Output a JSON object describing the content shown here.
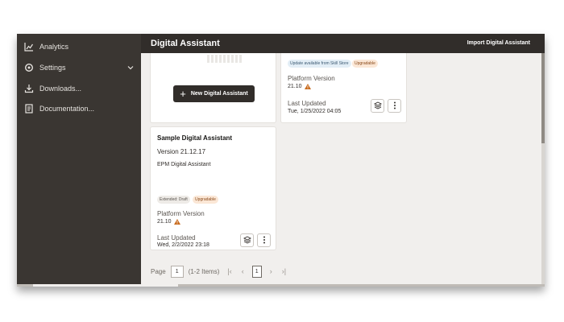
{
  "sidebar": {
    "items": [
      {
        "label": "Analytics",
        "icon": "analytics-icon"
      },
      {
        "label": "Settings",
        "icon": "gear-icon"
      },
      {
        "label": "Downloads...",
        "icon": "download-icon"
      },
      {
        "label": "Documentation...",
        "icon": "document-icon"
      }
    ]
  },
  "header": {
    "title": "Digital Assistant",
    "import_label": "Import Digital Assistant"
  },
  "cards": {
    "new_button_label": "New Digital Assistant",
    "second": {
      "badge_update": "Update available from Skill Store",
      "badge_upgradable": "Upgradable",
      "platform_label": "Platform Version",
      "platform_value": "21.10",
      "updated_label": "Last Updated",
      "updated_value": "Tue, 1/25/2022 04:05"
    },
    "sample": {
      "name": "Sample Digital Assistant",
      "version": "Version 21.12.17",
      "description": "EPM Digital Assistant",
      "badge_draft": "Extended: Draft",
      "badge_upgradable": "Upgradable",
      "platform_label": "Platform Version",
      "platform_value": "21.10",
      "updated_label": "Last Updated",
      "updated_value": "Wed, 2/2/2022 23:18"
    }
  },
  "pagination": {
    "page_label": "Page",
    "page_input": "1",
    "items_text": "(1-2 Items)",
    "current_page": "1"
  },
  "colors": {
    "sidebar_bg": "#3a3632",
    "header_bg": "#312d2a",
    "content_bg": "#f1efed",
    "warning": "#c86b1e"
  }
}
